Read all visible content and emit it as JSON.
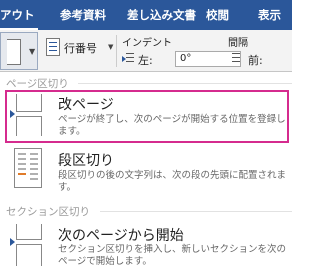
{
  "ribbon": {
    "tabs": [
      "アウト",
      "参考資料",
      "差し込み文書",
      "校閲",
      "表示"
    ],
    "line_numbers_label": "行番号",
    "indent_label": "インデント",
    "indent_left_label": "左:",
    "indent_left_value": "0°",
    "spacing_label": "間隔",
    "spacing_before_label": "前:"
  },
  "menu": {
    "section_page_breaks": "ページ区切り",
    "page_break_title": "改ページ",
    "page_break_desc": "ページが終了し、次のページが開始する位置を登録します。",
    "column_break_title": "段区切り",
    "column_break_desc": "段区切りの後の文字列は、次の段の先頭に配置されます。",
    "section_section_breaks": "セクション区切り",
    "next_page_title": "次のページから開始",
    "next_page_desc": "セクション区切りを挿入し、新しいセクションを次のページで開始します。"
  },
  "colors": {
    "ribbon_blue": "#2b579a",
    "highlight_magenta": "#d52b8e"
  }
}
